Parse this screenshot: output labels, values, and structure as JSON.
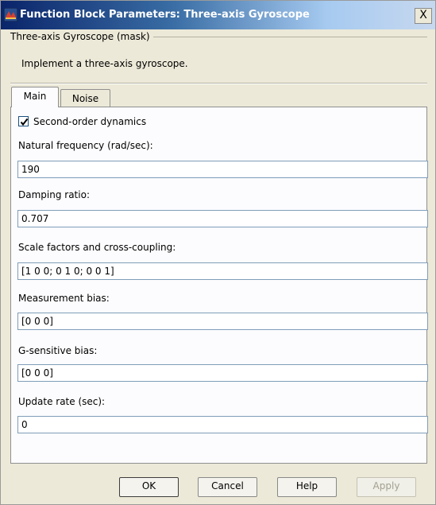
{
  "window": {
    "title": "Function Block Parameters: Three-axis Gyroscope",
    "close_label": "X"
  },
  "mask": {
    "legend": "Three-axis Gyroscope (mask)",
    "description": "Implement a three-axis gyroscope."
  },
  "tabs": [
    {
      "label": "Main",
      "selected": true
    },
    {
      "label": "Noise",
      "selected": false
    }
  ],
  "main": {
    "second_order": {
      "label": "Second-order dynamics",
      "checked": true
    },
    "fields": [
      {
        "label": "Natural frequency (rad/sec):",
        "value": "190"
      },
      {
        "label": "Damping ratio:",
        "value": "0.707"
      },
      {
        "label": "Scale factors and cross-coupling:",
        "value": "[1 0 0; 0 1 0; 0 0 1]"
      },
      {
        "label": "Measurement bias:",
        "value": "[0 0 0]"
      },
      {
        "label": "G-sensitive bias:",
        "value": "[0 0 0]"
      },
      {
        "label": "Update rate (sec):",
        "value": "0"
      }
    ]
  },
  "buttons": {
    "ok": "OK",
    "cancel": "Cancel",
    "help": "Help",
    "apply": "Apply"
  }
}
